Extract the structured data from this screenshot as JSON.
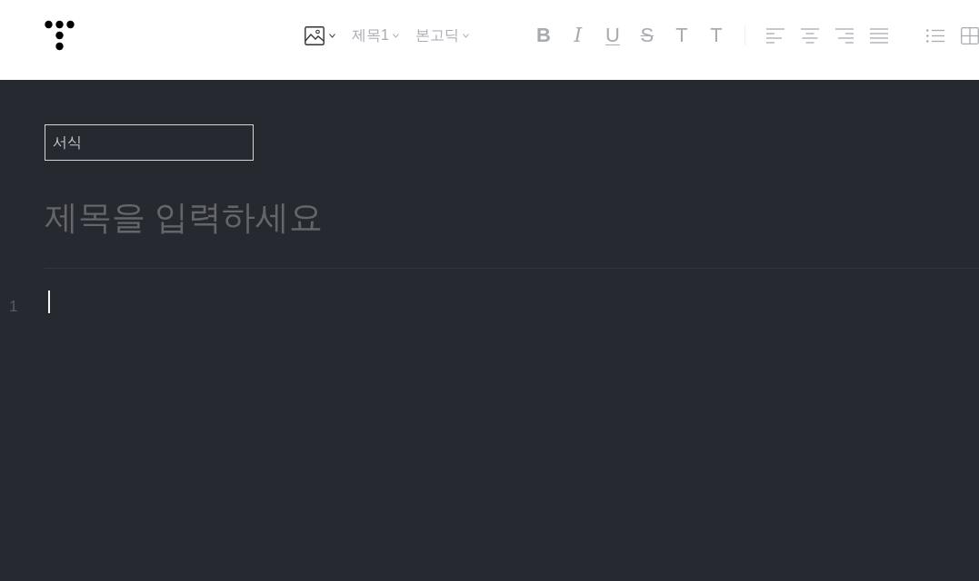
{
  "header": {
    "toolbar": [
      {
        "kind": "image",
        "disabled": false
      },
      {
        "kind": "dropdown",
        "label": "제목1",
        "disabled": true
      },
      {
        "kind": "dropdown",
        "label": "본고딕",
        "disabled": true
      },
      {
        "kind": "bold",
        "label": "B",
        "disabled": true
      },
      {
        "kind": "italic",
        "label": "I",
        "disabled": true
      },
      {
        "kind": "underline",
        "label": "U",
        "disabled": true
      },
      {
        "kind": "strike",
        "label": "S",
        "disabled": true
      },
      {
        "kind": "text",
        "label": "T",
        "disabled": true
      },
      {
        "kind": "text",
        "label": "T",
        "disabled": true
      },
      {
        "kind": "left",
        "disabled": true
      },
      {
        "kind": "center",
        "disabled": true
      },
      {
        "kind": "right",
        "disabled": true
      },
      {
        "kind": "justify",
        "disabled": true
      },
      {
        "kind": "bullets",
        "disabled": true
      },
      {
        "kind": "table",
        "disabled": true
      }
    ]
  },
  "format_select": {
    "value": "서식"
  },
  "title": {
    "placeholder": "제목을 입력하세요"
  },
  "editor": {
    "focused": true,
    "lines": [
      {
        "number": "1"
      }
    ]
  }
}
